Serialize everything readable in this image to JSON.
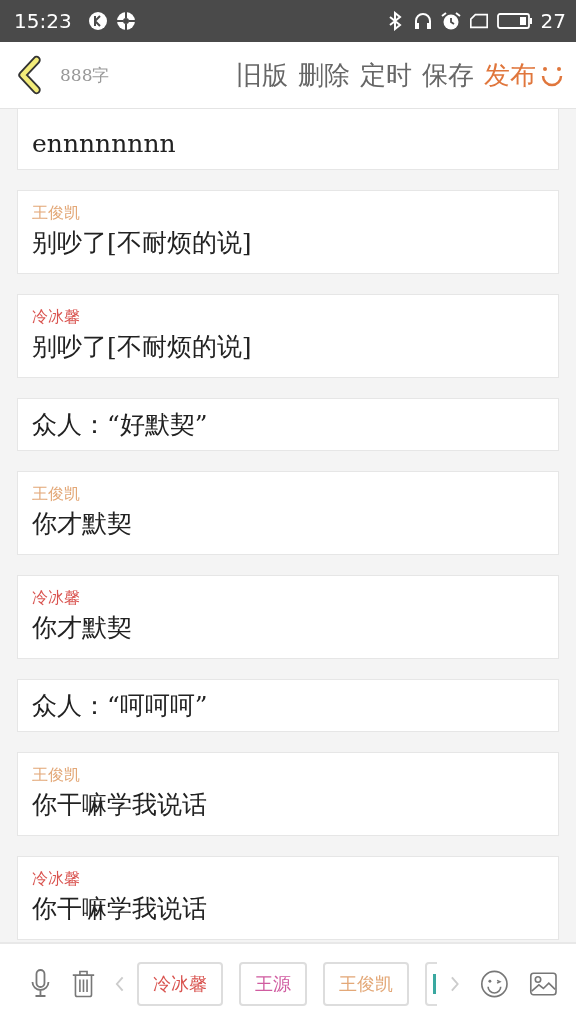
{
  "status_bar": {
    "time": "15:23",
    "battery": "27"
  },
  "header": {
    "word_count": "888字",
    "actions": [
      {
        "label": "旧版",
        "primary": false
      },
      {
        "label": "删除",
        "primary": false
      },
      {
        "label": "定时",
        "primary": false
      },
      {
        "label": "保存",
        "primary": false
      },
      {
        "label": "发布",
        "primary": true
      }
    ]
  },
  "messages": [
    {
      "text": "ennnnnnnn"
    },
    {
      "speaker": "王俊凯",
      "color": "#e3a878",
      "text": "别吵了[不耐烦的说]"
    },
    {
      "speaker": "冷冰馨",
      "color": "#d9534f",
      "text": "别吵了[不耐烦的说]"
    },
    {
      "text": "众人：“好默契”"
    },
    {
      "speaker": "王俊凯",
      "color": "#e3a878",
      "text": "你才默契"
    },
    {
      "speaker": "冷冰馨",
      "color": "#d9534f",
      "text": "你才默契"
    },
    {
      "text": "众人：“呵呵呵”"
    },
    {
      "speaker": "王俊凯",
      "color": "#e3a878",
      "text": "你干嘛学我说话"
    },
    {
      "speaker": "冷冰馨",
      "color": "#d9534f",
      "text": "你干嘛学我说话"
    }
  ],
  "speaker_chips": [
    {
      "name": "冷冰馨",
      "color": "#d9534f"
    },
    {
      "name": "王源",
      "color": "#d05ca0"
    },
    {
      "name": "王俊凯",
      "color": "#e3a878"
    },
    {
      "color": "#3aa8a0"
    }
  ]
}
